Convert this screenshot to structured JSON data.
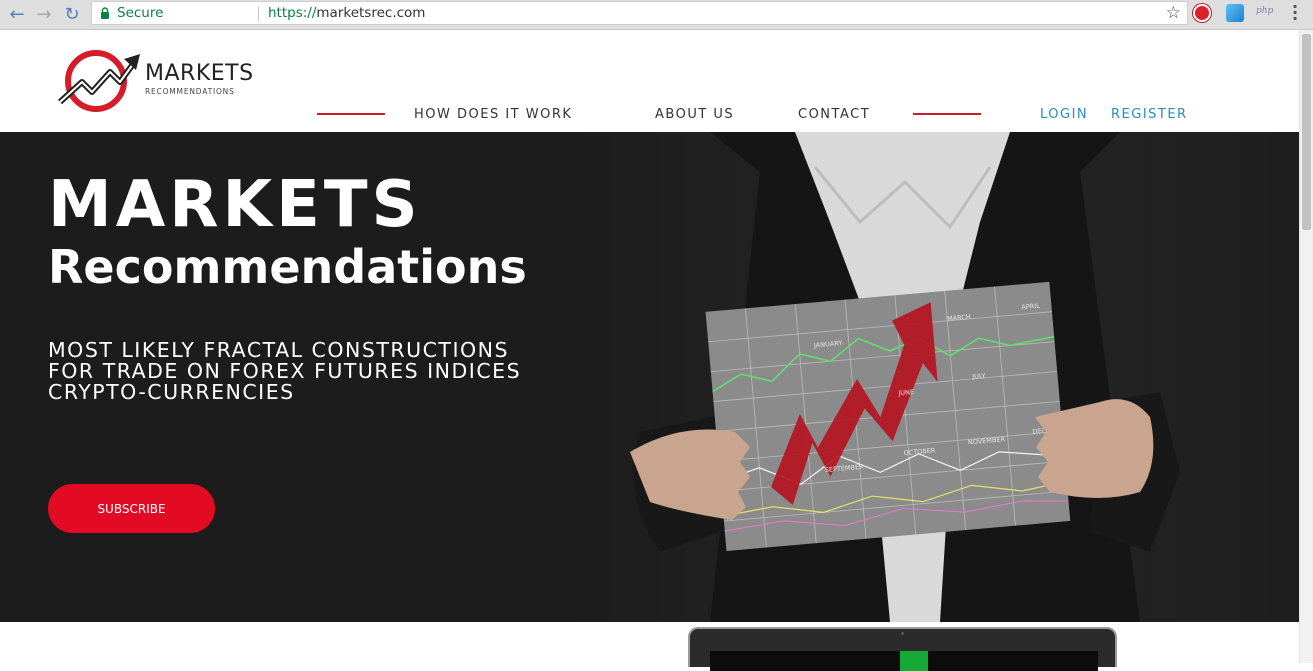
{
  "browser": {
    "secure_label": "Secure",
    "url_scheme": "https://",
    "url_host": "marketsrec.com",
    "ext3_label": "php"
  },
  "header": {
    "logo_title": "MARKETS",
    "logo_subtitle": "RECOMMENDATIONS",
    "nav": {
      "how": "HOW DOES IT WORK",
      "about": "ABOUT US",
      "contact": "CONTACT",
      "login": "LOGIN",
      "register": "REGISTER"
    },
    "accent_color": "#cc1c2a",
    "link_color": "#2a8bc1"
  },
  "hero": {
    "title": "MARKETS",
    "subtitle": "Recommendations",
    "tagline": [
      "MOST LIKELY FRACTAL CONSTRUCTIONS",
      "FOR TRADE ON FOREX FUTURES INDICES",
      "CRYPTO-CURRENCIES"
    ],
    "subscribe_label": "SUBSCRIBE",
    "subscribe_color": "#e30b24",
    "chart_months": [
      "JANUARY",
      "MARCH",
      "APRIL",
      "JUNE",
      "JULY",
      "SEPTEMBER",
      "OCTOBER",
      "NOVEMBER",
      "DECEMBER"
    ]
  }
}
